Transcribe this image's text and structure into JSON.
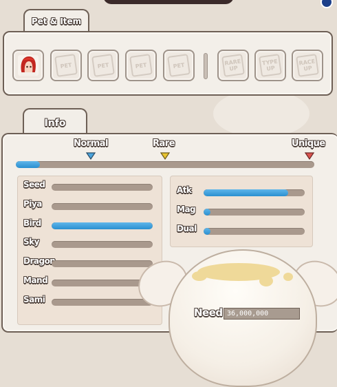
{
  "tabs": {
    "pet_item": "Pet & Item",
    "info": "Info"
  },
  "slots": [
    {
      "label": "",
      "state": "filled",
      "icon": "pet-portrait-red-hair"
    },
    {
      "label": "PET",
      "state": "empty"
    },
    {
      "label": "PET",
      "state": "empty"
    },
    {
      "label": "PET",
      "state": "empty"
    },
    {
      "label": "PET",
      "state": "empty"
    }
  ],
  "item_slots": [
    {
      "label": "RARE UP"
    },
    {
      "label": "TYPE UP"
    },
    {
      "label": "RACE UP"
    }
  ],
  "grades": {
    "labels": [
      "Normal",
      "Rare",
      "Unique"
    ],
    "marker_colors": [
      "#4aa3dc",
      "#e8c430",
      "#d9534f"
    ],
    "progress": 0.08
  },
  "types": [
    {
      "label": "Seed",
      "value": 0
    },
    {
      "label": "Piya",
      "value": 0
    },
    {
      "label": "Bird",
      "value": 1.0
    },
    {
      "label": "Sky",
      "value": 0
    },
    {
      "label": "Dragon",
      "value": 0
    },
    {
      "label": "Mand",
      "value": 0
    },
    {
      "label": "Sami",
      "value": 0
    }
  ],
  "stats": [
    {
      "label": "Atk",
      "value": 0.84
    },
    {
      "label": "Mag",
      "value": 0.07
    },
    {
      "label": "Dual",
      "value": 0.07
    }
  ],
  "need": {
    "label": "Need",
    "value": "36,000,000"
  },
  "colors": {
    "bar_fill": "#2a8fd0",
    "bar_track": "#a9998d",
    "panel": "#f3efe9",
    "border": "#6d5f55"
  }
}
